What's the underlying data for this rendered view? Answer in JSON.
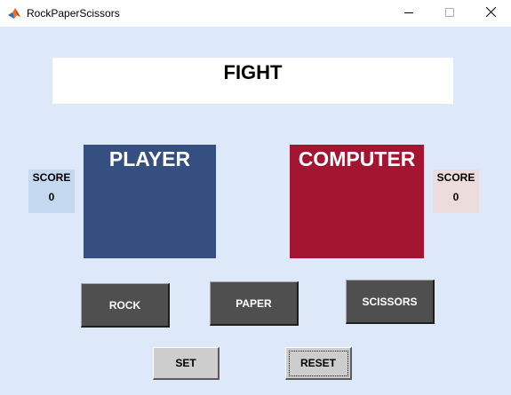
{
  "window": {
    "title": "RockPaperScissors",
    "icon": "matlab-icon",
    "controls": [
      "minimize-icon",
      "maximize-icon",
      "close-icon"
    ]
  },
  "result": {
    "text": "FIGHT"
  },
  "player": {
    "title": "PLAYER",
    "score_label": "SCORE",
    "score_value": "0",
    "color": "#344f80"
  },
  "computer": {
    "title": "COMPUTER",
    "score_label": "SCORE",
    "score_value": "0",
    "color": "#a31530"
  },
  "choices": {
    "rock": "ROCK",
    "paper": "PAPER",
    "scissors": "SCISSORS"
  },
  "controls": {
    "set": "SET",
    "reset": "RESET"
  },
  "colors": {
    "background": "#dde9f8",
    "choice_button": "#4f4f4f",
    "control_button": "#cdcdcd"
  }
}
